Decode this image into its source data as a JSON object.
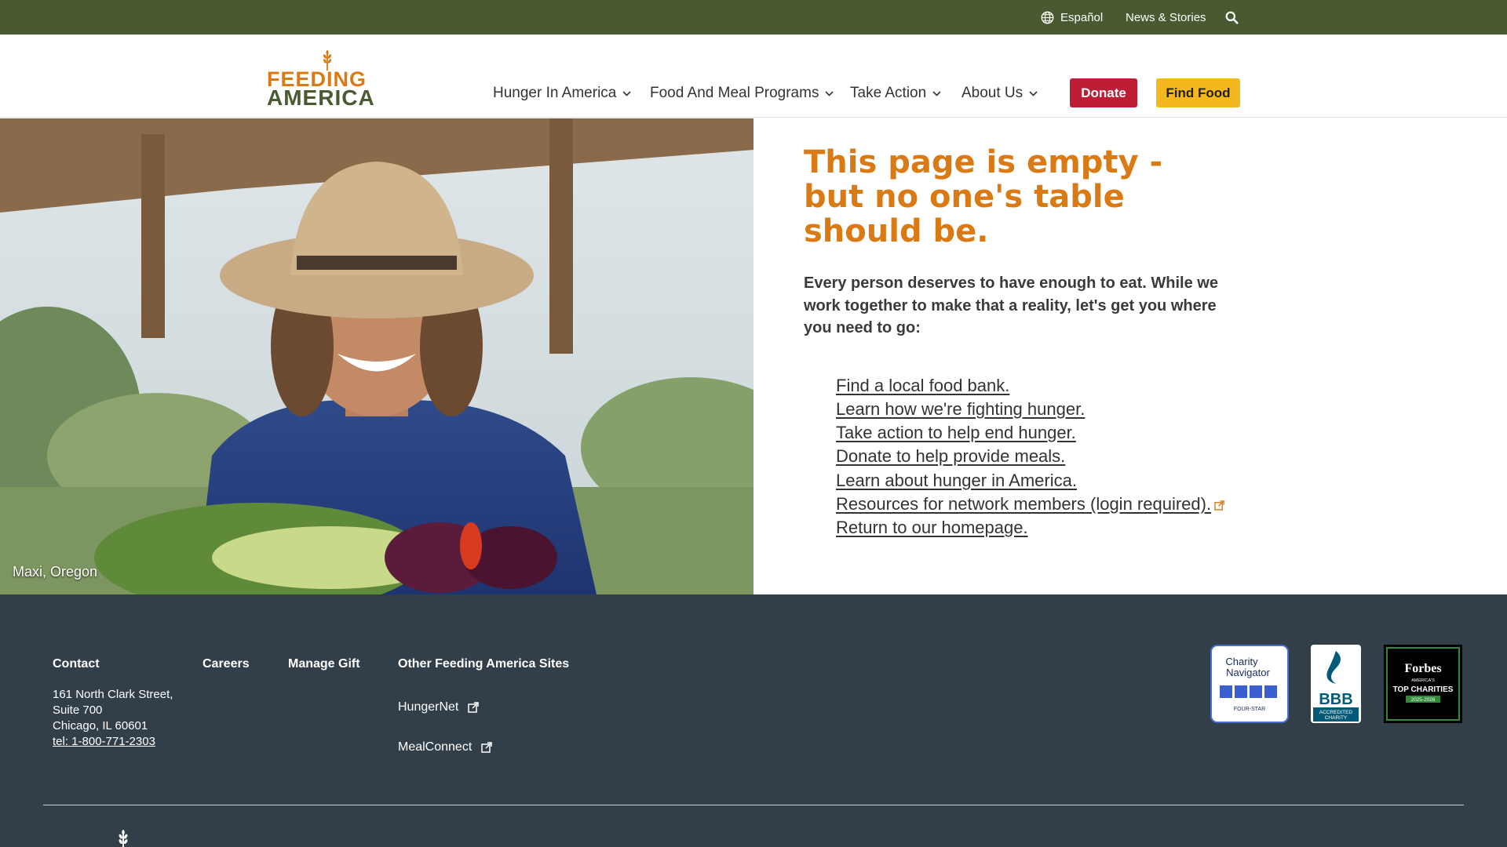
{
  "utility": {
    "language": "Español",
    "news": "News & Stories",
    "search_icon": "search-icon",
    "globe_icon": "globe-icon"
  },
  "header": {
    "logo_word1": "FEEDING",
    "logo_word2": "AMERICA",
    "nav": [
      {
        "label": "Hunger In America"
      },
      {
        "label": "Food And Meal Programs"
      },
      {
        "label": "Take Action"
      },
      {
        "label": "About Us"
      }
    ],
    "donate_label": "Donate",
    "find_food_label": "Find Food"
  },
  "hero": {
    "photo_caption": "Maxi, Oregon",
    "heading": "This page is empty - but no one's table should be.",
    "lead": "Every person deserves to have enough to eat. While we work together to make that a reality, let's get you where you need to go:",
    "links": [
      "Find a local food bank.",
      "Learn how we're fighting hunger.",
      "Take action to help end hunger.",
      "Donate to help provide meals.",
      "Learn about hunger in America.",
      "Resources for network members (login required).",
      "Return to our homepage."
    ]
  },
  "footer": {
    "contact_title": "Contact",
    "address1": "161 North Clark Street,",
    "address2": "Suite 700",
    "address3": "Chicago, IL 60601",
    "phone": "tel: 1-800-771-2303",
    "careers": "Careers",
    "manage_gift": "Manage Gift",
    "other_sites_title": "Other Feeding America Sites",
    "hungernet": "HungerNet",
    "mealconnect": "MealConnect",
    "badges": {
      "charity_navigator_1": "Charity",
      "charity_navigator_2": "Navigator",
      "charity_navigator_3": "FOUR-STAR",
      "bbb_1": "BBB",
      "bbb_2": "ACCREDITED",
      "bbb_3": "CHARITY",
      "forbes_1": "Forbes",
      "forbes_2": "AMERICA'S",
      "forbes_3": "TOP CHARITIES",
      "forbes_4": "2025-2026"
    }
  },
  "colors": {
    "utility_bar": "#4a5a30",
    "brand_orange": "#d97a14",
    "donate_red": "#bd1e36",
    "find_food_yellow": "#f5b81c",
    "footer_bg": "#333f48"
  }
}
